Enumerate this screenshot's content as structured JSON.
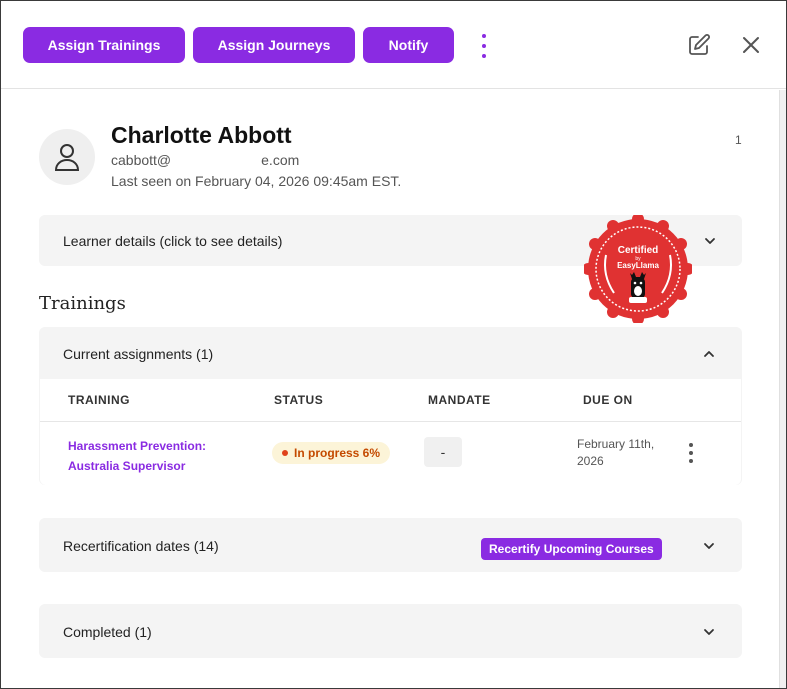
{
  "toolbar": {
    "assign_trainings_label": "Assign Trainings",
    "assign_journeys_label": "Assign Journeys",
    "notify_label": "Notify",
    "more_icon": "kebab-vertical-icon",
    "edit_icon": "edit-icon",
    "close_icon": "close-icon"
  },
  "profile": {
    "name": "Charlotte Abbott",
    "email_prefix": "cabbott@",
    "email_suffix": "e.com",
    "last_seen": "Last seen on February 04, 2026 09:45am EST.",
    "counter": "1"
  },
  "learner_details": {
    "title": "Learner details (click to see details)"
  },
  "badge": {
    "line1": "Certified",
    "line2": "by",
    "line3": "EasyLlama"
  },
  "trainings": {
    "heading": "Trainings",
    "current": {
      "title": "Current assignments (1)",
      "columns": [
        "TRAINING",
        "STATUS",
        "MANDATE",
        "DUE ON"
      ],
      "rows": [
        {
          "training_line1": "Harassment Prevention:",
          "training_line2": "Australia Supervisor",
          "status": "In progress 6%",
          "mandate": "-",
          "due_line1": "February 11th,",
          "due_line2": "2026"
        }
      ]
    },
    "recertification": {
      "title": "Recertification dates (14)",
      "button_label": "Recertify Upcoming Courses"
    },
    "completed": {
      "title": "Completed (1)"
    }
  },
  "colors": {
    "accent": "#8a2be2",
    "status_text": "#c44a00",
    "status_bg": "#fcf4d8",
    "badge_red": "#e03232"
  }
}
